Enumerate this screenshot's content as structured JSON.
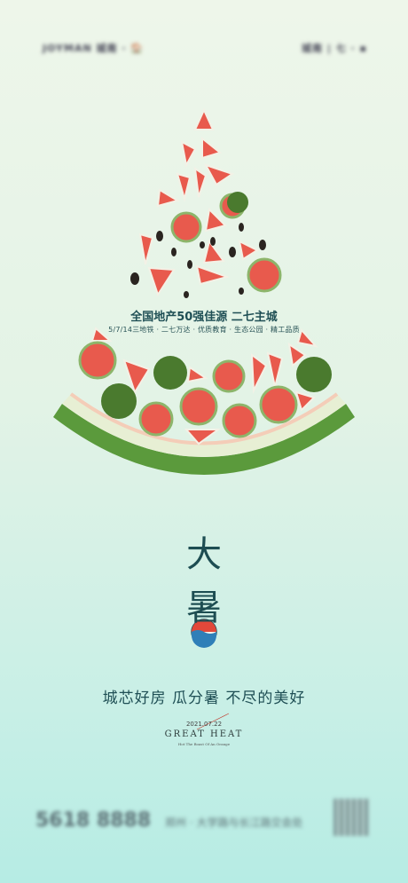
{
  "header": {
    "left_logo": "JOYMAN 城南 · 🏠",
    "right_logo": "城南 | 七 · ▪"
  },
  "poster": {
    "headline": "全国地产50强佳源 二七主城",
    "subline": "5/7/14三地铁 · 二七万达 · 优质教育 · 生态公园 · 精工品质",
    "char_top": "大",
    "char_bottom": "暑",
    "slogan": "城芯好房  瓜分暑 不尽的美好",
    "date": "2021.07.22",
    "title_en": "GREAT HEAT",
    "title_en_sub": "Hot The Boast Of An Orange"
  },
  "footer": {
    "phone": "5618 8888",
    "address": "郑州 · 大学路与长江路交会处"
  },
  "colors": {
    "rind_green": "#5b9a3c",
    "rind_light": "#e7efd4",
    "flesh": "#e85a4d",
    "text_teal": "#1f4f55",
    "sun_red": "#e2483a",
    "wave_blue": "#2f7fb8"
  }
}
